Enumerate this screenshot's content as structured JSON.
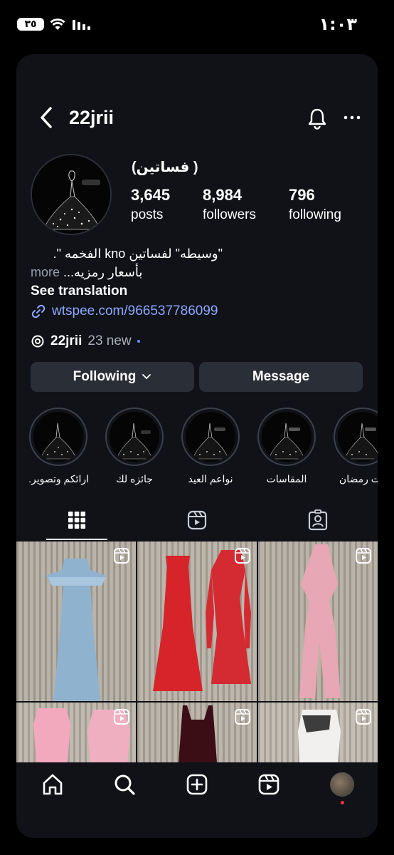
{
  "status_bar": {
    "battery": "٣٥",
    "time": "١:٠٣",
    "wifi_icon": "wifi-icon",
    "signal_icon": "signal-icon"
  },
  "header": {
    "username": "22jrii",
    "back_icon": "chevron-left-icon",
    "bell_icon": "bell-icon",
    "more_icon": "more-horizontal-icon"
  },
  "profile": {
    "name": "(فساتين )",
    "stats": [
      {
        "value": "3,645",
        "label": "posts"
      },
      {
        "value": "8,984",
        "label": "followers"
      },
      {
        "value": "796",
        "label": "following"
      }
    ],
    "bio_line1": "\"وسيطه\" لفساتين kno الفخمه \".",
    "bio_line2_more": "more",
    "bio_line2_text": "...بأسعار رمزيه",
    "see_translation": "See translation",
    "link": "wtspee.com/966537786099",
    "threads_name": "22jrii",
    "threads_new": "23 new"
  },
  "buttons": {
    "following": "Following",
    "message": "Message"
  },
  "highlights": [
    {
      "label": "ارائكم وتصوير..."
    },
    {
      "label": "جائزه لك"
    },
    {
      "label": "نواعم العيد"
    },
    {
      "label": "المقاسات"
    },
    {
      "label": "بات رمضان"
    }
  ],
  "tabs": [
    "grid-icon",
    "reels-icon",
    "tagged-icon"
  ],
  "nav": [
    "home-icon",
    "search-icon",
    "create-icon",
    "reels-icon",
    "profile-avatar"
  ],
  "colors": {
    "background": "#101218",
    "button": "#2a2e36",
    "link": "#8ea8ff",
    "notification_dot": "#ff3040"
  }
}
